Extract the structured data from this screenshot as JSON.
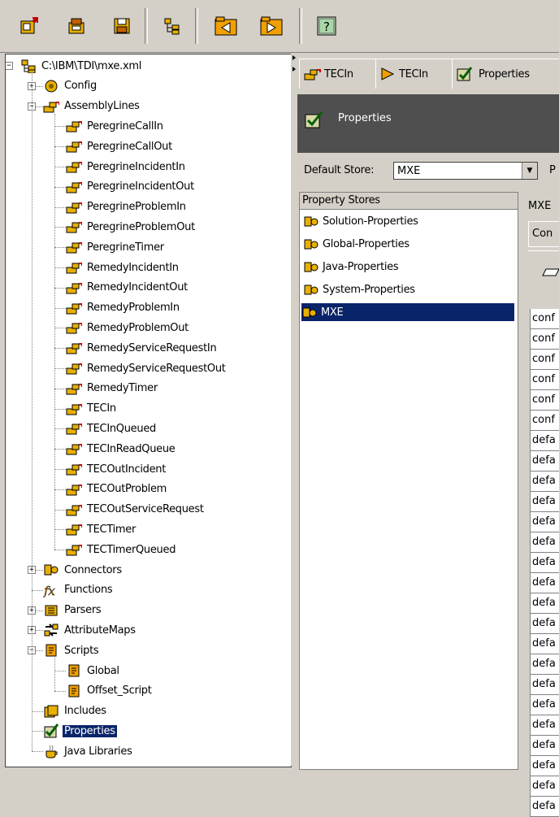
{
  "toolbar": {
    "buttons": [
      "new-assembly-line",
      "new-connector",
      "save",
      "tree-view",
      "back",
      "forward",
      "help"
    ]
  },
  "tree": {
    "root": "C:\\IBM\\TDI\\mxe.xml",
    "config": "Config",
    "assembly_lines_label": "AssemblyLines",
    "assembly_lines": [
      "PeregrineCallIn",
      "PeregrineCallOut",
      "PeregrineIncidentIn",
      "PeregrineIncidentOut",
      "PeregrineProblemIn",
      "PeregrineProblemOut",
      "PeregrineTimer",
      "RemedyIncidentIn",
      "RemedyIncidentOut",
      "RemedyProblemIn",
      "RemedyProblemOut",
      "RemedyServiceRequestIn",
      "RemedyServiceRequestOut",
      "RemedyTimer",
      "TECIn",
      "TECInQueued",
      "TECInReadQueue",
      "TECOutIncident",
      "TECOutProblem",
      "TECOutServiceRequest",
      "TECTimer",
      "TECTimerQueued"
    ],
    "connectors": "Connectors",
    "functions": "Functions",
    "parsers": "Parsers",
    "attribute_maps": "AttributeMaps",
    "scripts": "Scripts",
    "script_items": [
      "Global",
      "Offset_Script"
    ],
    "includes": "Includes",
    "properties": "Properties",
    "java_libraries": "Java Libraries"
  },
  "tabs": [
    {
      "label": "TECIn"
    },
    {
      "label": "TECIn"
    },
    {
      "label": "Properties"
    }
  ],
  "header": {
    "title": "Properties"
  },
  "store": {
    "label": "Default Store:",
    "value": "MXE",
    "extra": "P"
  },
  "property_stores": {
    "header": "Property Stores",
    "items": [
      "Solution-Properties",
      "Global-Properties",
      "Java-Properties",
      "System-Properties",
      "MXE"
    ]
  },
  "right_panel": {
    "title": "MXE",
    "tab": "Con",
    "cells": [
      "conf",
      "conf",
      "conf",
      "conf",
      "conf",
      "conf",
      "defa",
      "defa",
      "defa",
      "defa",
      "defa",
      "defa",
      "defa",
      "defa",
      "defa",
      "defa",
      "defa",
      "defa",
      "defa",
      "defa",
      "defa",
      "defa",
      "defa",
      "defa",
      "defa"
    ]
  }
}
